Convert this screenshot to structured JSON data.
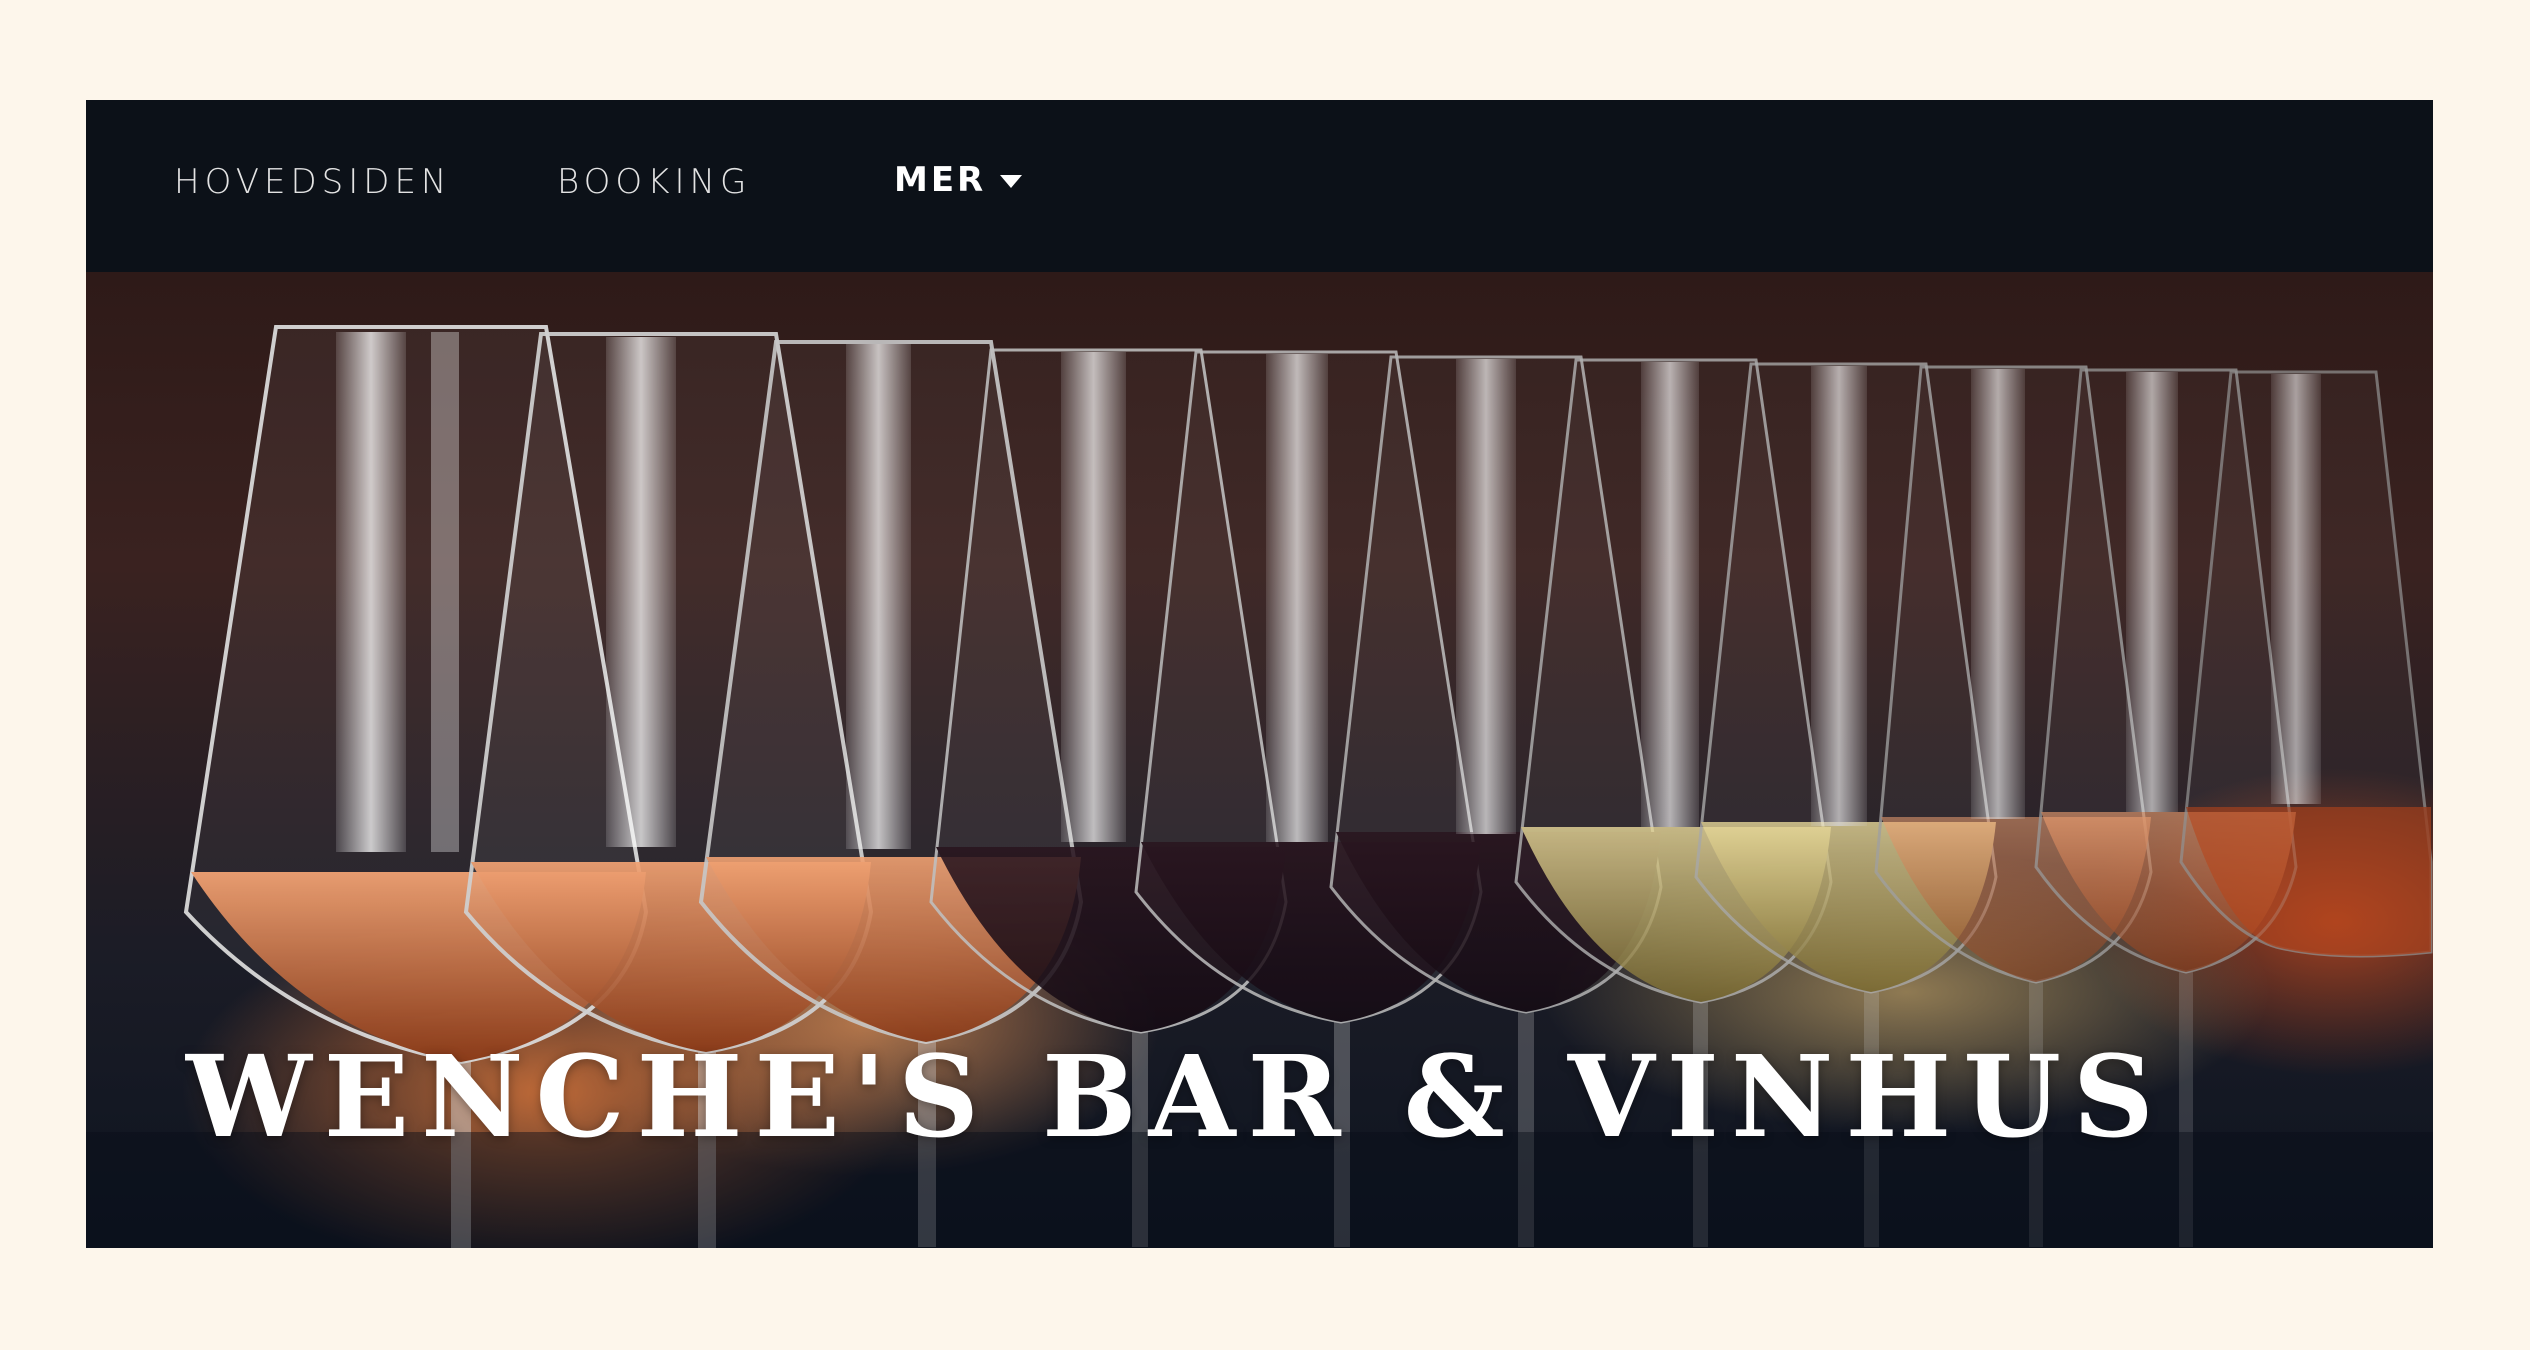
{
  "nav": {
    "items": [
      {
        "label": "HOVEDSIDEN"
      },
      {
        "label": "BOOKING"
      },
      {
        "label": "MER",
        "icon": "caret-down-icon"
      }
    ]
  },
  "hero": {
    "title": "WENCHE'S BAR & VINHUS",
    "image": "row-of-wine-glasses-photo"
  },
  "colors": {
    "page_background": "#fdf6eb",
    "nav_background": "#0c1118",
    "nav_text": "#e3e3e3",
    "title_text": "#ffffff"
  }
}
